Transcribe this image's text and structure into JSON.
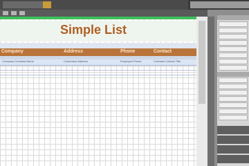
{
  "document": {
    "title": "Simple List",
    "columns": [
      "Company",
      "Address",
      "Phone",
      "Contact"
    ],
    "rows": [
      [
        "Company Contacts Name",
        "Customers Address",
        "Employee Phone",
        "Contacts Contact Title"
      ]
    ]
  },
  "colors": {
    "title_color": "#b05f22",
    "header_bg": "#b8743a",
    "accent_green": "#3fbf5c"
  }
}
